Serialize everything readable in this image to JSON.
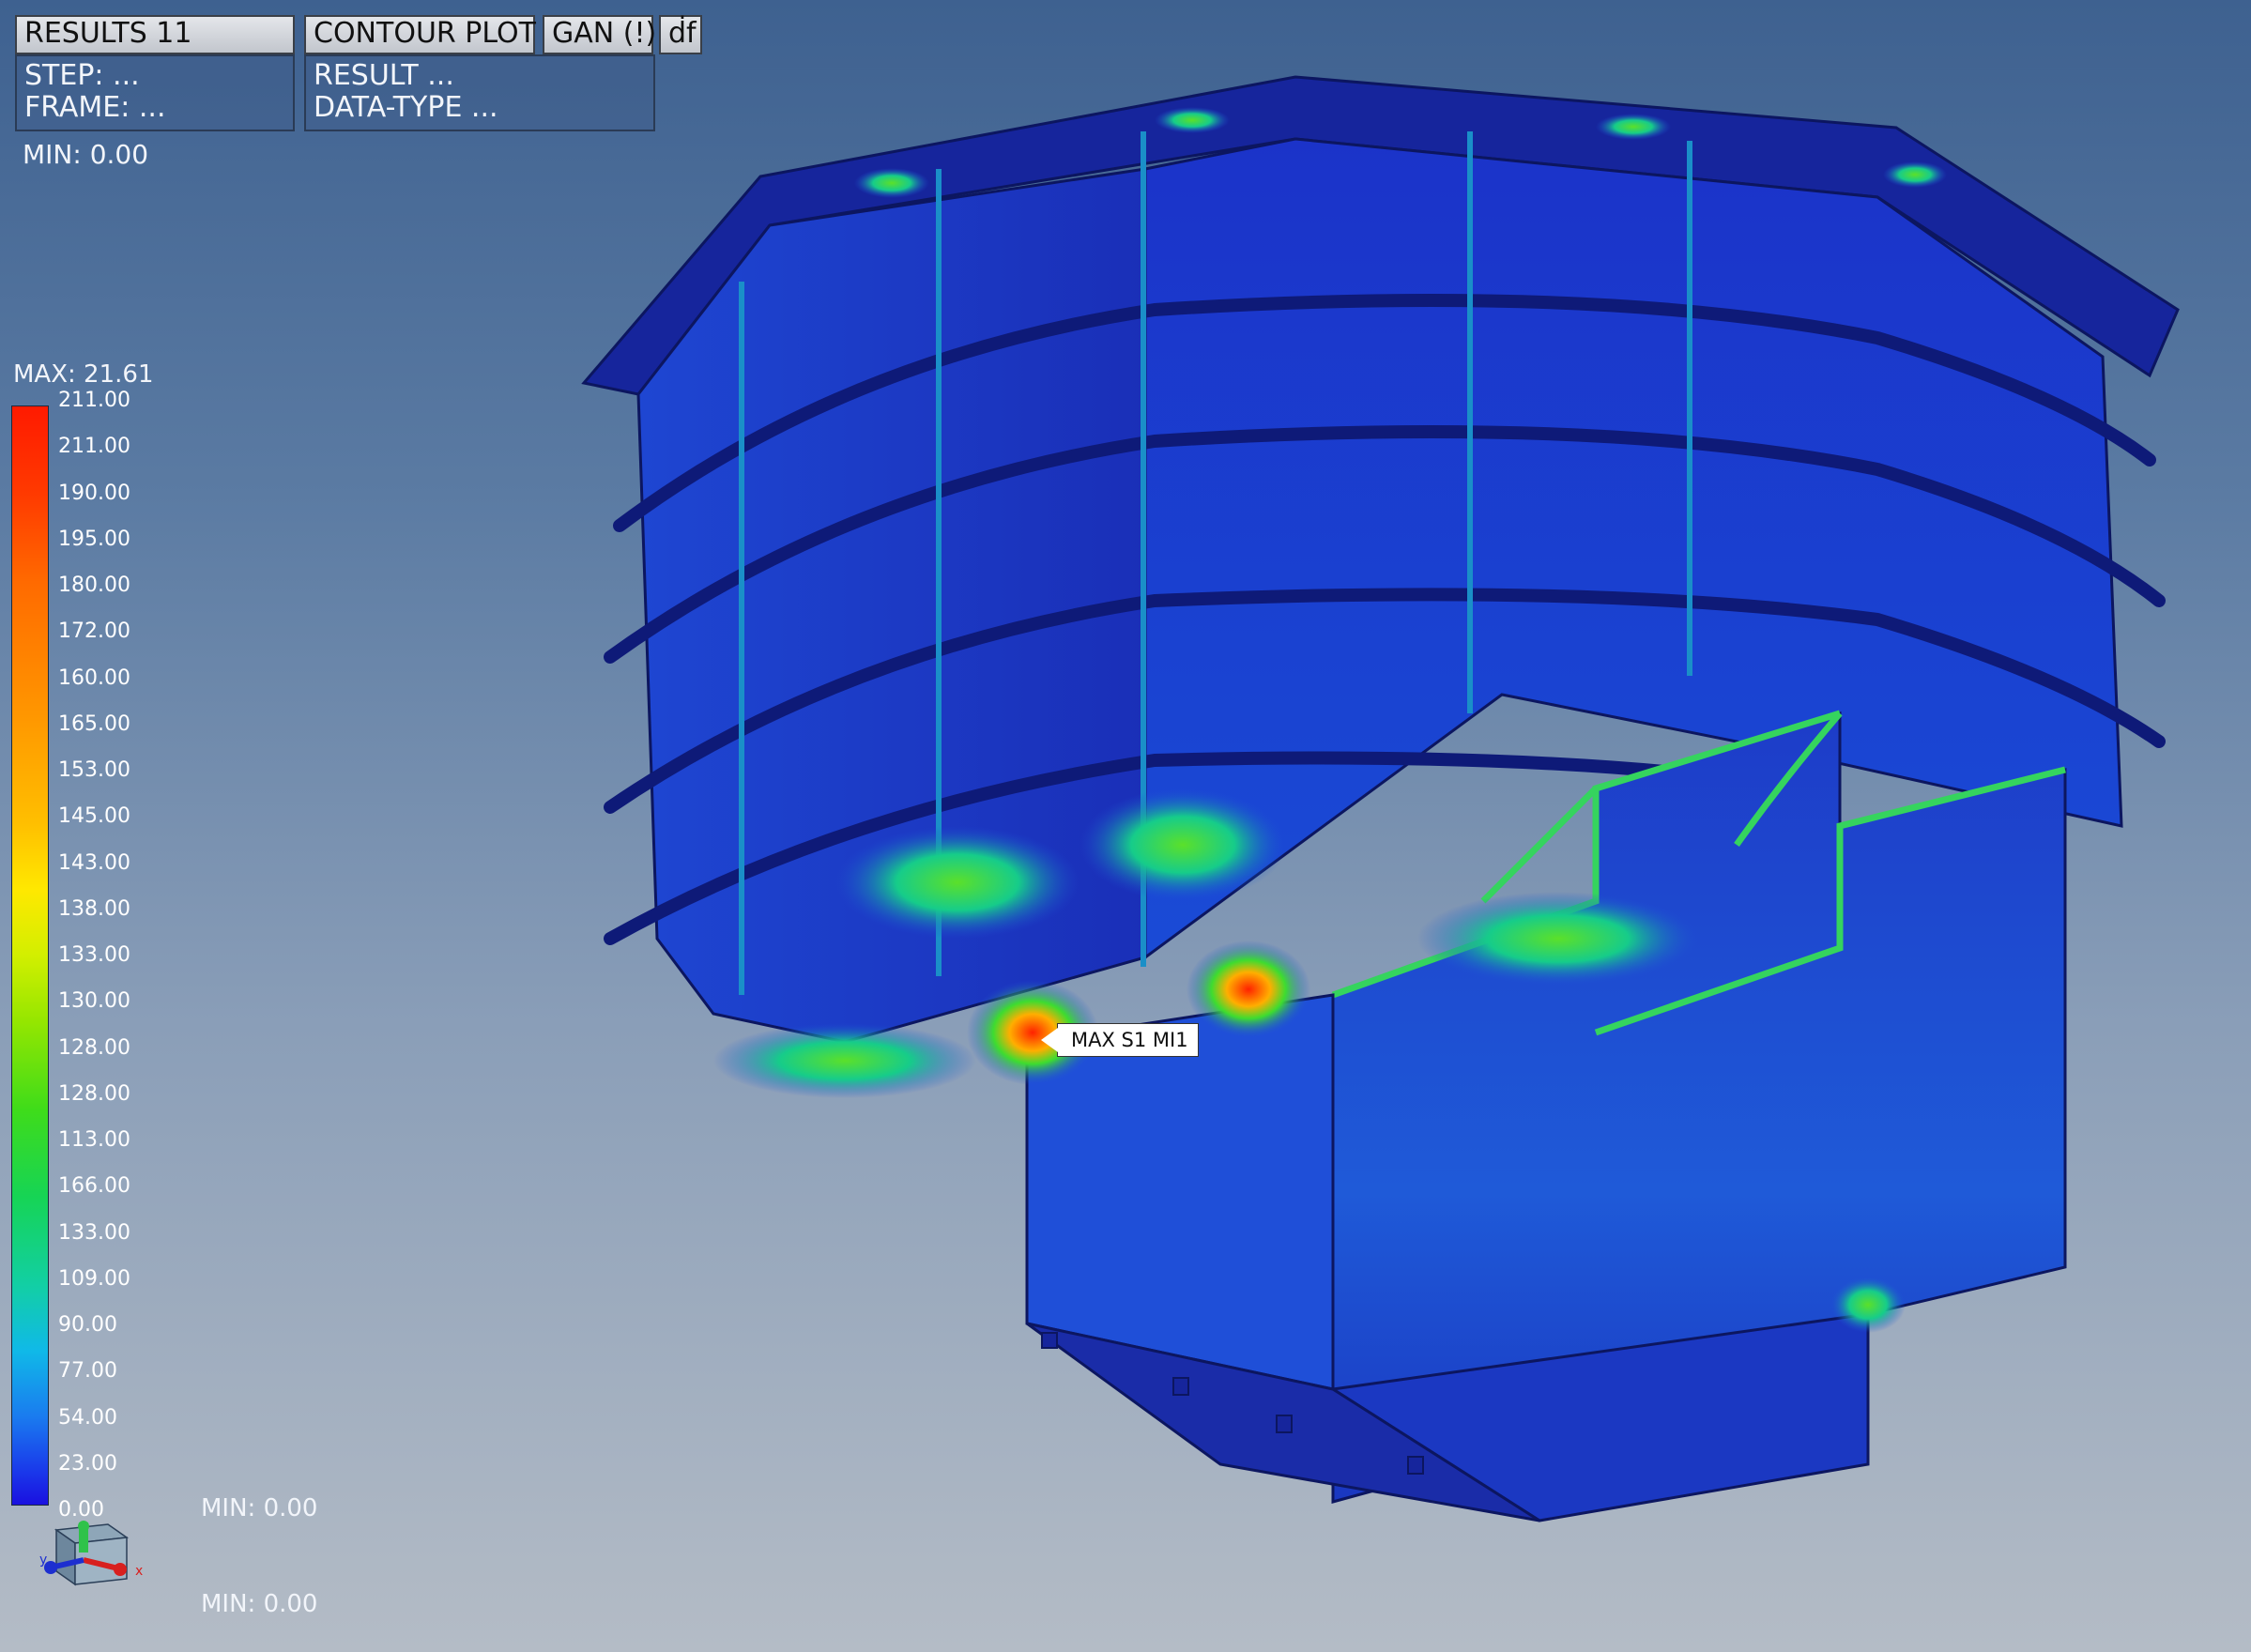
{
  "header": {
    "results_label": "RESULTS 11",
    "contour_label": "CONTOUR PLOT",
    "gan_label": "GAN (!)",
    "df_label": "ḋf",
    "step_text": "STEP: ...",
    "frame_text": "FRAME: ...",
    "result_text": "RESULT ...",
    "datatype_text": "DATA-TYPE ..."
  },
  "min_top": "MIN: 0.00",
  "legend": {
    "max_text": "MAX: 21.61",
    "labels": [
      "211.00",
      "211.00",
      "190.00",
      "195.00",
      "180.00",
      "172.00",
      "160.00",
      "165.00",
      "153.00",
      "145.00",
      "143.00",
      "138.00",
      "133.00",
      "130.00",
      "128.00",
      "128.00",
      "113.00",
      "166.00",
      "133.00",
      "109.00",
      "90.00",
      "77.00",
      "54.00",
      "23.00",
      "0.00"
    ],
    "colors": {
      "max": "#ff1a00",
      "mid": "#ffe800",
      "low": "#16d455",
      "min": "#1a10e0"
    }
  },
  "min_bottom_1": "MIN: 0.00",
  "min_bottom_2": "MIN: 0.00",
  "callout_text": "MAX S1 MI1",
  "triad": {
    "x_axis": "x",
    "y_axis": "y"
  },
  "model": {
    "base_color": "#1f3fc4",
    "hot_color": "#ff2a00",
    "warm_color": "#22d45a"
  }
}
